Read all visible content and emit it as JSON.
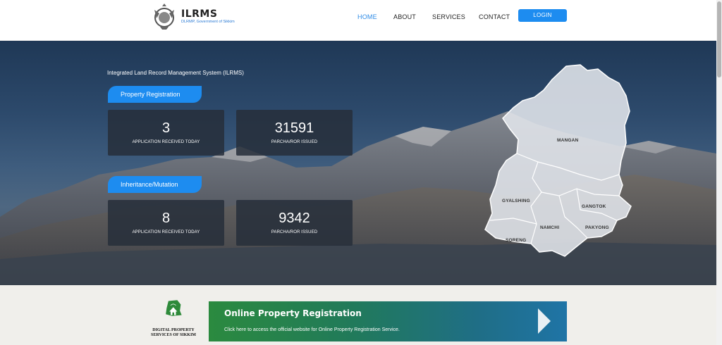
{
  "header": {
    "logo_title": "ILRMS",
    "logo_subtitle": "DLRMP, Government of Sikkim",
    "nav": [
      {
        "label": "HOME"
      },
      {
        "label": "ABOUT"
      },
      {
        "label": "SERVICES"
      },
      {
        "label": "CONTACT"
      }
    ],
    "login_label": "LOGIN"
  },
  "hero": {
    "heading": "Integrated Land Record Management System (ILRMS)",
    "sections": [
      {
        "title": "Property Registration",
        "stats": [
          {
            "value": "3",
            "label": "APPLICATION RECEIVED TODAY"
          },
          {
            "value": "31591",
            "label": "PARCHA/ROR ISSUED"
          }
        ]
      },
      {
        "title": "Inheritance/Mutation",
        "stats": [
          {
            "value": "8",
            "label": "APPLICATION RECEIVED TODAY"
          },
          {
            "value": "9342",
            "label": "PARCHA/ROR ISSUED"
          }
        ]
      }
    ],
    "districts": [
      "MANGAN",
      "GYALSHING",
      "GANGTOK",
      "NAMCHI",
      "PAKYONG",
      "SORENG"
    ]
  },
  "services": {
    "logo_text": [
      "DIGITAL PROPERTY",
      "SERVICES OF SIKKIM"
    ],
    "banner_title": "Online Property Registration",
    "banner_subtitle": "Click here to access the official website for Online Property Registration Service.",
    "banner_arrow_icon": "play-arrow-icon"
  },
  "colors": {
    "accent": "#1d8cf0",
    "nav_active": "#2e8be6",
    "stat_card": "#262e3a",
    "banner_start": "#2b8a3f",
    "banner_end": "#1f74a6"
  }
}
